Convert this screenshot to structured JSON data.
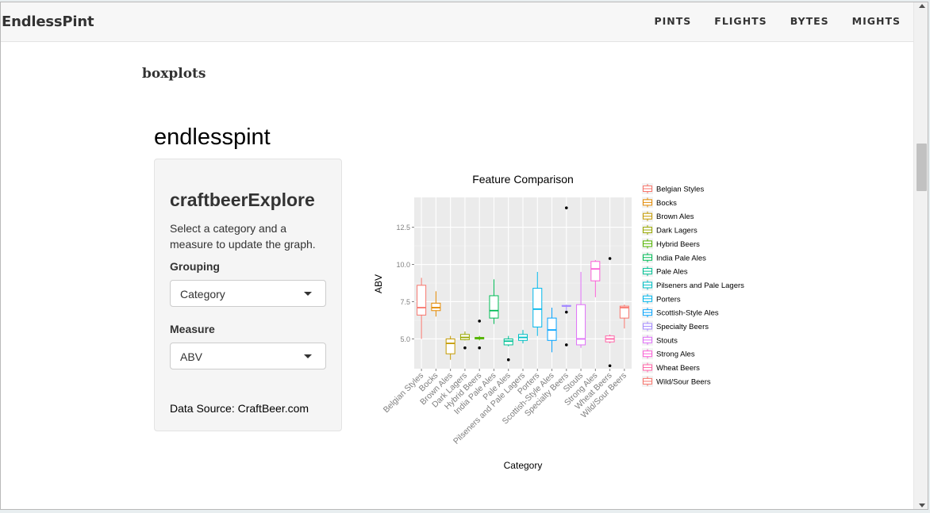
{
  "navbar": {
    "brand": "EndlessPint",
    "links": [
      "PINTS",
      "FLIGHTS",
      "BYTES",
      "MIGHTS"
    ]
  },
  "page": {
    "heading": "boxplots",
    "app_title": "endlesspint"
  },
  "sidebar": {
    "panel_title": "craftbeerExplore",
    "description": "Select a category and a measure to update the graph.",
    "grouping_label": "Grouping",
    "grouping_value": "Category",
    "measure_label": "Measure",
    "measure_value": "ABV",
    "data_source": "Data Source: CraftBeer.com"
  },
  "chart_data": {
    "type": "boxplot",
    "title": "Feature Comparison",
    "xlabel": "Category",
    "ylabel": "ABV",
    "ylim": [
      3.0,
      14.5
    ],
    "yticks": [
      5.0,
      7.5,
      10.0,
      12.5
    ],
    "ytick_labels": [
      "5.0",
      "7.5",
      "10.0",
      "12.5"
    ],
    "grid": true,
    "legend_position": "right",
    "categories": [
      "Belgian Styles",
      "Bocks",
      "Brown Ales",
      "Dark Lagers",
      "Hybrid Beers",
      "India Pale Ales",
      "Pale Ales",
      "Pilseners and Pale Lagers",
      "Porters",
      "Scottish-Style Ales",
      "Specialty Beers",
      "Stouts",
      "Strong Ales",
      "Wheat Beers",
      "Wild/Sour Beers"
    ],
    "series": [
      {
        "name": "Belgian Styles",
        "color": "#F8766D",
        "min": 5.0,
        "q1": 6.6,
        "median": 7.1,
        "q3": 8.6,
        "max": 9.1,
        "outliers": []
      },
      {
        "name": "Bocks",
        "color": "#E38900",
        "min": 6.5,
        "q1": 6.9,
        "median": 7.1,
        "q3": 7.4,
        "max": 8.2,
        "outliers": []
      },
      {
        "name": "Brown Ales",
        "color": "#C49A00",
        "min": 3.6,
        "q1": 4.0,
        "median": 4.7,
        "q3": 5.0,
        "max": 5.2,
        "outliers": []
      },
      {
        "name": "Dark Lagers",
        "color": "#99A800",
        "min": 4.9,
        "q1": 4.95,
        "median": 5.1,
        "q3": 5.3,
        "max": 5.5,
        "outliers": [
          4.4
        ]
      },
      {
        "name": "Hybrid Beers",
        "color": "#53B400",
        "min": 4.9,
        "q1": 5.0,
        "median": 5.05,
        "q3": 5.1,
        "max": 5.2,
        "outliers": [
          6.2,
          4.4
        ]
      },
      {
        "name": "India Pale Ales",
        "color": "#00BC56",
        "min": 6.0,
        "q1": 6.4,
        "median": 6.9,
        "q3": 7.9,
        "max": 9.0,
        "outliers": []
      },
      {
        "name": "Pale Ales",
        "color": "#00C094",
        "min": 4.5,
        "q1": 4.6,
        "median": 4.85,
        "q3": 5.0,
        "max": 5.2,
        "outliers": [
          3.6
        ]
      },
      {
        "name": "Pilseners and Pale Lagers",
        "color": "#00BFC4",
        "min": 4.7,
        "q1": 4.9,
        "median": 5.1,
        "q3": 5.3,
        "max": 5.6,
        "outliers": []
      },
      {
        "name": "Porters",
        "color": "#00B6EB",
        "min": 5.2,
        "q1": 5.8,
        "median": 7.0,
        "q3": 8.4,
        "max": 9.5,
        "outliers": []
      },
      {
        "name": "Scottish-Style Ales",
        "color": "#06A4FF",
        "min": 4.1,
        "q1": 4.9,
        "median": 5.6,
        "q3": 6.4,
        "max": 7.1,
        "outliers": []
      },
      {
        "name": "Specialty Beers",
        "color": "#A58AFF",
        "min": 6.9,
        "q1": 7.2,
        "median": 7.2,
        "q3": 7.25,
        "max": 7.3,
        "outliers": [
          13.8,
          6.8,
          4.6
        ]
      },
      {
        "name": "Stouts",
        "color": "#DF70F8",
        "min": 4.4,
        "q1": 4.6,
        "median": 5.0,
        "q3": 7.3,
        "max": 9.5,
        "outliers": []
      },
      {
        "name": "Strong Ales",
        "color": "#FB61D7",
        "min": 7.8,
        "q1": 8.9,
        "median": 9.7,
        "q3": 10.2,
        "max": 10.3,
        "outliers": []
      },
      {
        "name": "Wheat Beers",
        "color": "#FF66A8",
        "min": 4.7,
        "q1": 4.8,
        "median": 5.0,
        "q3": 5.2,
        "max": 5.3,
        "outliers": [
          10.4,
          3.2
        ]
      },
      {
        "name": "Wild/Sour Beers",
        "color": "#F8766D",
        "min": 5.7,
        "q1": 6.4,
        "median": 7.1,
        "q3": 7.2,
        "max": 7.3,
        "outliers": []
      }
    ]
  }
}
